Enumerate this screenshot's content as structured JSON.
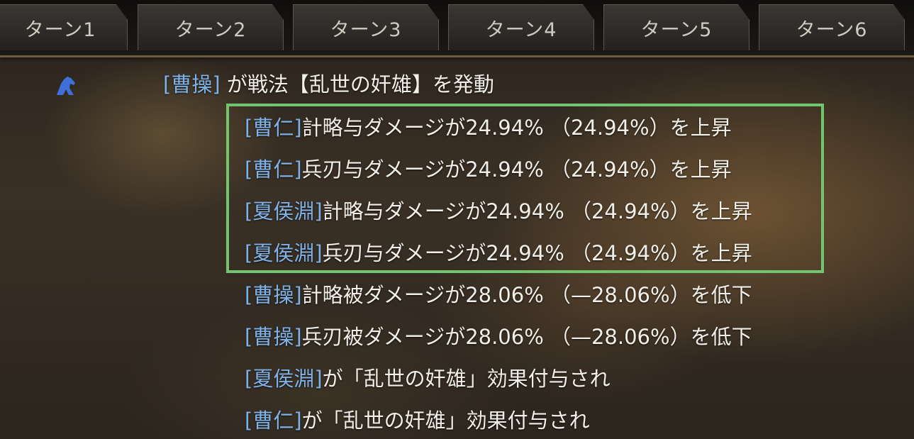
{
  "tabs": [
    {
      "label": "ターン1"
    },
    {
      "label": "ターン2"
    },
    {
      "label": "ターン3"
    },
    {
      "label": "ターン4"
    },
    {
      "label": "ターン5"
    },
    {
      "label": "ターン6"
    }
  ],
  "log": {
    "header": {
      "actor": "[曹操]",
      "text": " が戦法【乱世の奸雄】を発動"
    },
    "lines": [
      {
        "name": "[曹仁]",
        "text": "計略与ダメージが24.94% （24.94%）を上昇"
      },
      {
        "name": "[曹仁]",
        "text": "兵刃与ダメージが24.94% （24.94%）を上昇"
      },
      {
        "name": "[夏侯淵]",
        "text": "計略与ダメージが24.94% （24.94%）を上昇"
      },
      {
        "name": "[夏侯淵]",
        "text": "兵刃与ダメージが24.94% （24.94%）を上昇"
      },
      {
        "name": "[曹操]",
        "text": "計略被ダメージが28.06% （—28.06%）を低下"
      },
      {
        "name": "[曹操]",
        "text": "兵刃被ダメージが28.06% （—28.06%）を低下"
      },
      {
        "name": "[夏侯淵]",
        "text": "が「乱世の奸雄」効果付与され"
      },
      {
        "name": "[曹仁]",
        "text": "が「乱世の奸雄」効果付与され"
      }
    ]
  },
  "icons": {
    "header_icon": "horse-icon"
  },
  "colors": {
    "name_color": "#7fb2e8",
    "highlight_border": "#73c46e",
    "text": "#f2efe8"
  }
}
